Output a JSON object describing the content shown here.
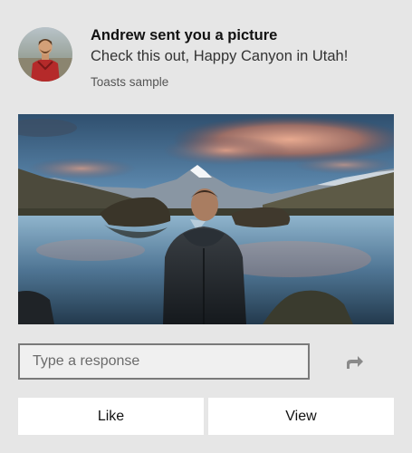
{
  "toast": {
    "title": "Andrew sent you a picture",
    "body": "Check this out, Happy Canyon in Utah!",
    "attribution": "Toasts sample",
    "avatar_icon": "person-avatar",
    "hero_image": "mountain-lake-landscape"
  },
  "reply": {
    "placeholder": "Type a response",
    "value": "",
    "send_icon": "share-arrow-icon"
  },
  "actions": {
    "like_label": "Like",
    "view_label": "View"
  },
  "colors": {
    "background": "#e6e6e6",
    "button_bg": "#ffffff",
    "input_border": "#7a7a7a"
  }
}
